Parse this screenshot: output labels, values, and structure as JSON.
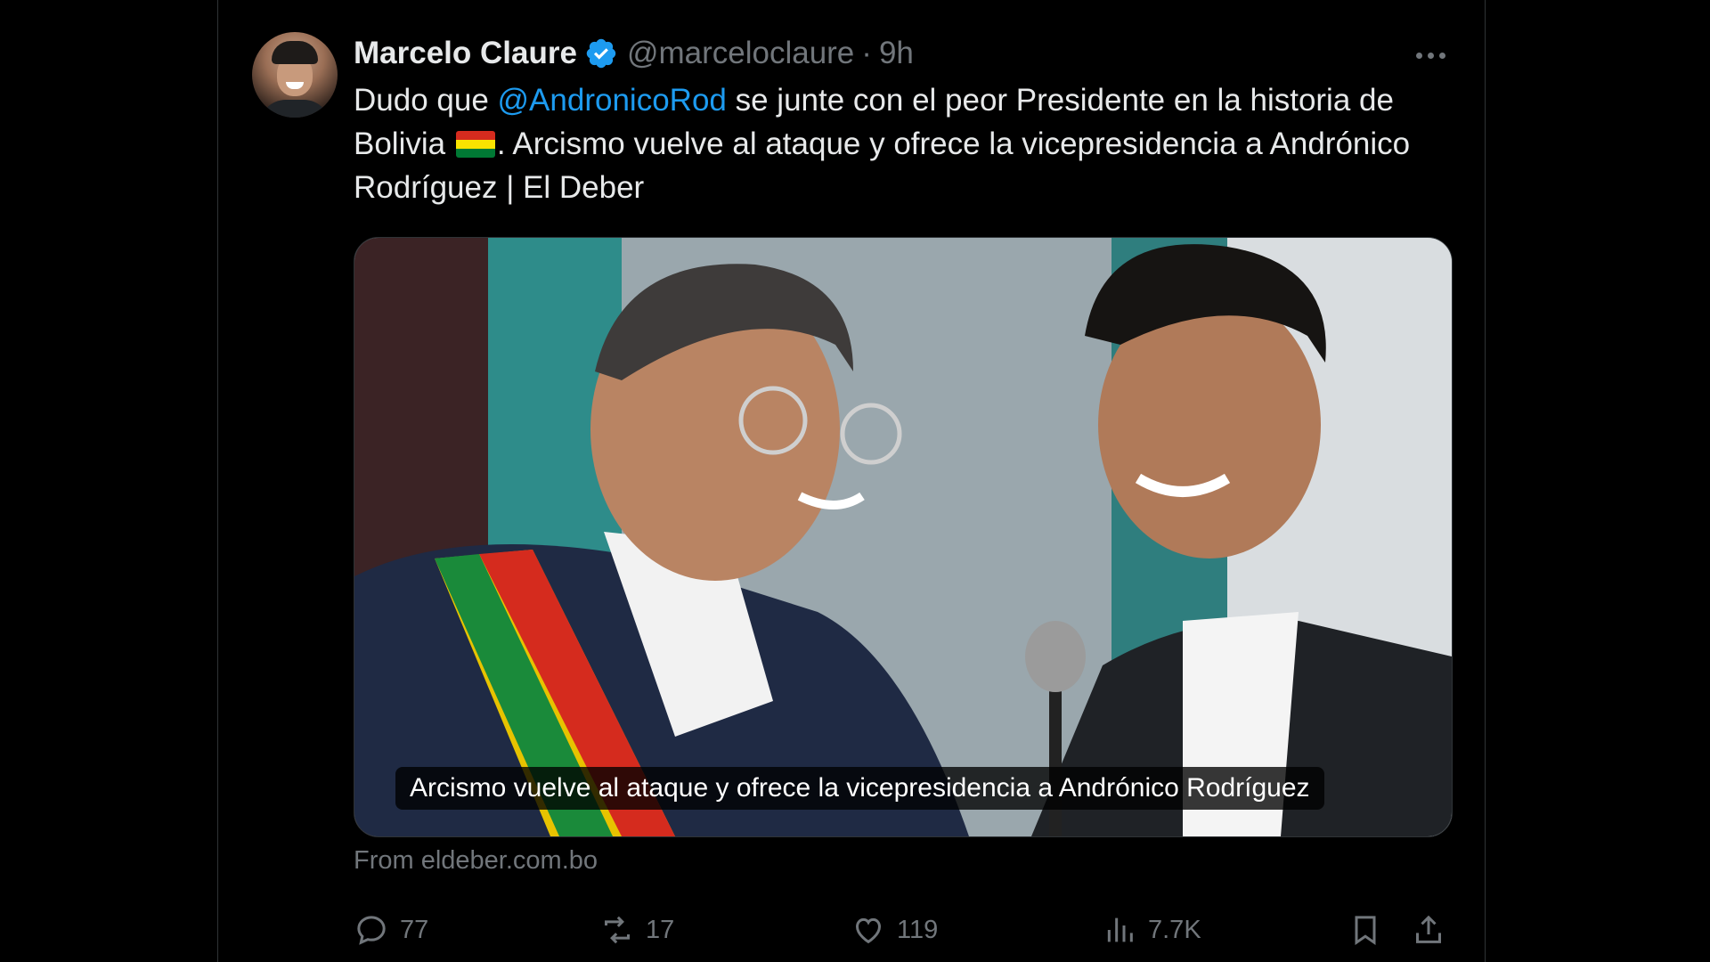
{
  "tweet": {
    "author_name": "Marcelo Claure",
    "handle": "@marceloclaure",
    "separator": "·",
    "time": "9h",
    "text_part1": "Dudo que ",
    "mention": "@AndronicoRod",
    "text_part2": " se junte con el peor Presidente en la historia de Bolivia ",
    "text_part3": ". Arcismo vuelve al ataque y ofrece la vicepresidencia a Andrónico Rodríguez | El Deber"
  },
  "card": {
    "caption": "Arcismo vuelve al ataque y ofrece la vicepresidencia a Andrónico Rodríguez",
    "source": "From eldeber.com.bo"
  },
  "actions": {
    "replies": "77",
    "reposts": "17",
    "likes": "119",
    "views": "7.7K"
  },
  "icons": {
    "verified": "verified-badge-icon",
    "more": "more-dots-icon",
    "reply": "reply-icon",
    "repost": "repost-icon",
    "like": "heart-icon",
    "views": "bar-chart-icon",
    "bookmark": "bookmark-icon",
    "share": "share-icon",
    "flag": "bolivia-flag-emoji"
  },
  "colors": {
    "background": "#000000",
    "text": "#e7e9ea",
    "secondary": "#71767b",
    "link": "#1d9bf0",
    "verified": "#1d9bf0"
  }
}
